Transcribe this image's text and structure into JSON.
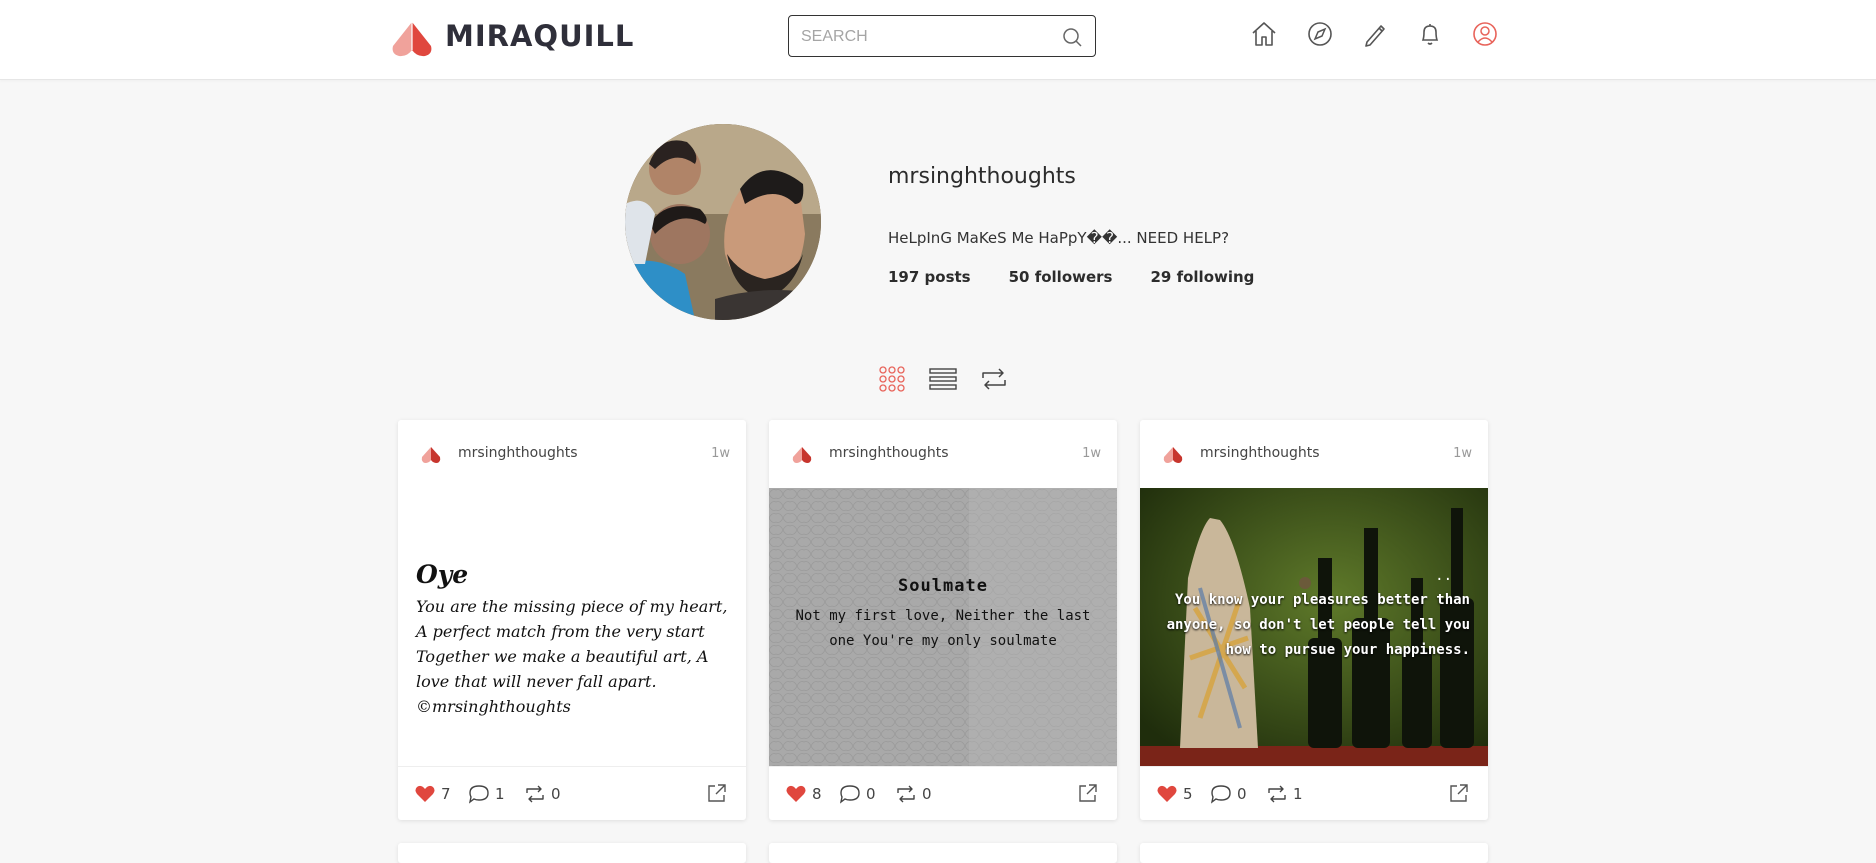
{
  "header": {
    "brand": "MIRAQUILL",
    "search": {
      "placeholder": "SEARCH",
      "value": ""
    },
    "nav_icons": [
      "home-icon",
      "compass-icon",
      "pen-icon",
      "bell-icon",
      "user-icon"
    ]
  },
  "profile": {
    "username": "mrsinghthoughts",
    "bio": "HeLpInG MaKeS Me HaPpY��... NEED HELP?",
    "posts": "197 posts",
    "followers": "50 followers",
    "following": "29 following"
  },
  "view_toggles": [
    "grid-view-icon",
    "list-view-icon",
    "repost-view-icon"
  ],
  "colors": {
    "accent": "#e8635a",
    "brand_dark": "#2f2f3a",
    "background": "#f7f7f7"
  },
  "posts": [
    {
      "user": "mrsinghthoughts",
      "time": "1w",
      "title": "Oye",
      "body": "You are the missing piece of my heart, A perfect match from the very start Together we make a beautiful art, A love that will never fall apart. ©mrsinghthoughts",
      "likes": "7",
      "comments": "1",
      "reposts": "0"
    },
    {
      "user": "mrsinghthoughts",
      "time": "1w",
      "title": "Soulmate",
      "body": "Not my first love, Neither the last one You're my only soulmate",
      "likes": "8",
      "comments": "0",
      "reposts": "0"
    },
    {
      "user": "mrsinghthoughts",
      "time": "1w",
      "dots": "..",
      "body": "You know your pleasures better than anyone, so don't let people tell you how to pursue your happiness.",
      "likes": "5",
      "comments": "0",
      "reposts": "1"
    }
  ]
}
